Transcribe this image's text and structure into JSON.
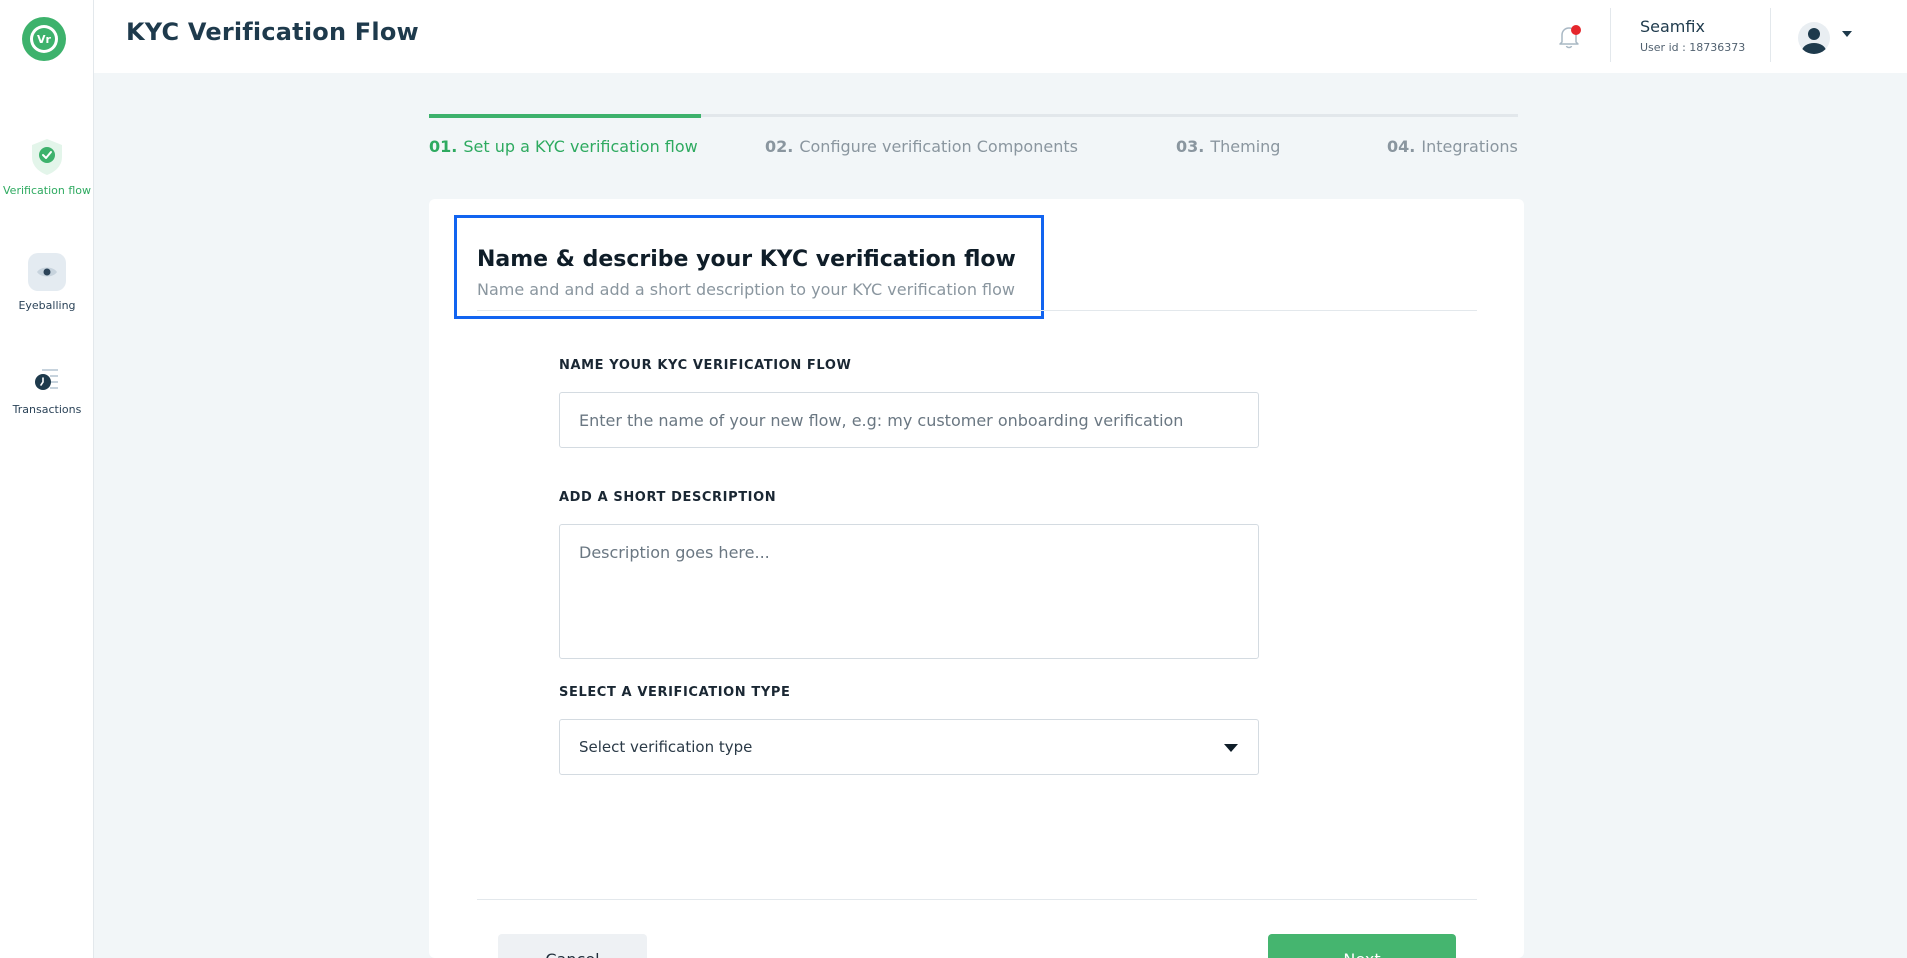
{
  "app": {
    "logo_text": "Vr"
  },
  "sidebar": {
    "items": [
      {
        "label": "Verification flow",
        "icon": "shield-check-icon",
        "active": true
      },
      {
        "label": "Eyeballing",
        "icon": "eye-icon",
        "active": false
      },
      {
        "label": "Transactions",
        "icon": "transactions-icon",
        "active": false
      }
    ]
  },
  "header": {
    "title": "KYC Verification Flow",
    "notification_icon": "bell-icon",
    "user": {
      "name": "Seamfix",
      "id_label": "User id : 18736373"
    }
  },
  "stepper": {
    "progress": 0.25,
    "steps": [
      {
        "num": "01.",
        "label": "Set up a KYC verification flow",
        "active": true
      },
      {
        "num": "02.",
        "label": "Configure verification Components",
        "active": false
      },
      {
        "num": "03.",
        "label": "Theming",
        "active": false
      },
      {
        "num": "04.",
        "label": "Integrations",
        "active": false
      }
    ]
  },
  "form": {
    "title": "Name & describe your KYC verification flow",
    "subtitle": "Name and and add a short description to your KYC verification flow",
    "name_field": {
      "label": "NAME YOUR KYC VERIFICATION FLOW",
      "placeholder": "Enter the name of your new flow, e.g: my customer onboarding verification",
      "value": ""
    },
    "description_field": {
      "label": "ADD A SHORT DESCRIPTION",
      "placeholder": "Description goes here...",
      "value": ""
    },
    "type_field": {
      "label": "SELECT A VERIFICATION TYPE",
      "selected": "Select verification type"
    },
    "cancel_label": "Cancel",
    "next_label": "Next"
  },
  "colors": {
    "accent": "#2eaa60",
    "highlight": "#1264f0",
    "title": "#1e3a4c",
    "notification_dot": "#e5262c"
  }
}
